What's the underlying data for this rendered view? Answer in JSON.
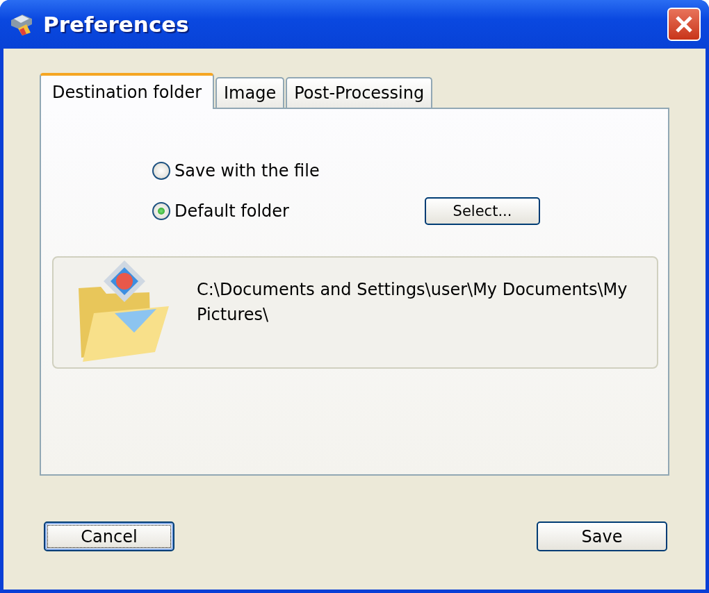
{
  "window": {
    "title": "Preferences"
  },
  "tabs": [
    {
      "label": "Destination folder",
      "selected": true
    },
    {
      "label": "Image",
      "selected": false
    },
    {
      "label": "Post-Processing",
      "selected": false
    }
  ],
  "options": [
    {
      "label": "Save with the file",
      "selected": false
    },
    {
      "label": "Default folder",
      "selected": true
    }
  ],
  "select_button": "Select...",
  "folder_path": "C:\\Documents and Settings\\user\\My Documents\\My Pictures\\",
  "buttons": [
    {
      "label": "Cancel",
      "focused": true
    },
    {
      "label": "Save",
      "focused": false
    }
  ]
}
